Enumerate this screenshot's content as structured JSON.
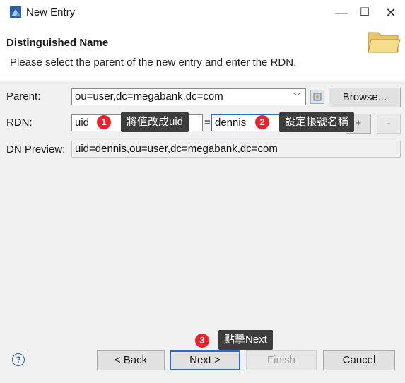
{
  "window": {
    "title": "New Entry",
    "minimize": "—",
    "maximize": "☐",
    "close": "✕"
  },
  "header": {
    "title": "Distinguished Name",
    "description": "Please select the parent of the new entry and enter the RDN."
  },
  "form": {
    "parent_label": "Parent:",
    "parent_value": "ou=user,dc=megabank,dc=com",
    "browse_label": "Browse...",
    "rdn_label": "RDN:",
    "rdn_type": "uid",
    "rdn_equals": "=",
    "rdn_value": "dennis",
    "add_label": "+",
    "remove_label": "-",
    "dn_preview_label": "DN Preview:",
    "dn_preview_value": "uid=dennis,ou=user,dc=megabank,dc=com"
  },
  "annotations": [
    {
      "number": "1",
      "text": "將值改成uid"
    },
    {
      "number": "2",
      "text": "設定帳號名稱"
    },
    {
      "number": "3",
      "text": "點擊Next"
    }
  ],
  "footer": {
    "help": "?",
    "back_label": "< Back",
    "next_label": "Next >",
    "finish_label": "Finish",
    "cancel_label": "Cancel"
  },
  "colors": {
    "badge": "#e8242b",
    "callout": "#3d3d3d",
    "accent": "#2a6cbf"
  }
}
